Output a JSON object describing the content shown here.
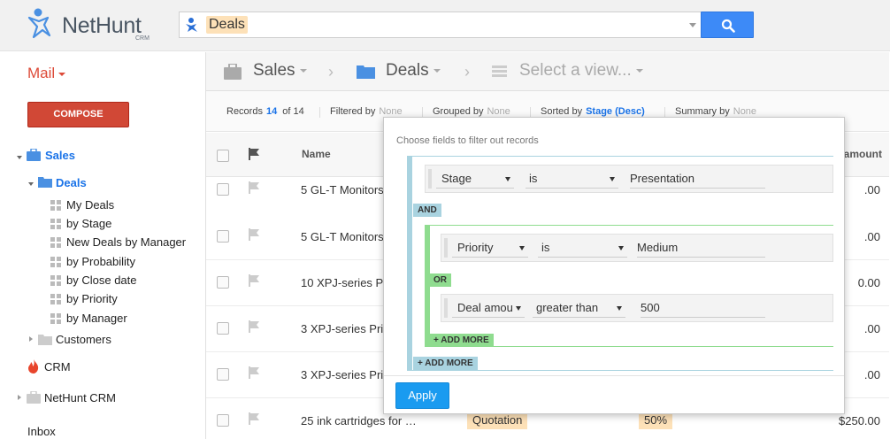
{
  "app": {
    "logo": "NetHunt",
    "logo_sub": "CRM"
  },
  "search": {
    "chip": "Deals"
  },
  "sidebar": {
    "mail": "Mail",
    "compose": "COMPOSE",
    "sales": "Sales",
    "deals": "Deals",
    "views": [
      "My Deals",
      "by Stage",
      "New Deals by Manager",
      "by Probability",
      "by Close date",
      "by Priority",
      "by Manager"
    ],
    "customers": "Customers",
    "crm": "CRM",
    "nethunt_crm": "NetHunt CRM",
    "inbox": "Inbox"
  },
  "breadcrumb": {
    "folder": "Sales",
    "collection": "Deals",
    "view": "Select a view..."
  },
  "stats": {
    "records_label": "Records",
    "records_shown": "14",
    "records_total": "of 14",
    "filtered_label": "Filtered by",
    "filtered_value": "None",
    "grouped_label": "Grouped by",
    "grouped_value": "None",
    "sorted_label": "Sorted by",
    "sorted_value": "Stage (Desc)",
    "summary_label": "Summary by",
    "summary_value": "None"
  },
  "table": {
    "headers": {
      "name": "Name",
      "amount": "amount"
    },
    "rows": [
      {
        "name": "5 GL-T Monitors",
        "amount": ".00"
      },
      {
        "name": "5 GL-T Monitors",
        "amount": ".00"
      },
      {
        "name": "10 XPJ-series P",
        "amount": "0.00"
      },
      {
        "name": "3 XPJ-series Pri",
        "amount": ".00"
      },
      {
        "name": "3 XPJ-series Pri",
        "amount": ".00"
      },
      {
        "name": "25 ink cartridges for …",
        "stage": "Quotation",
        "probability": "50%",
        "amount": "$250.00"
      }
    ]
  },
  "filter": {
    "title": "Choose fields to filter out records",
    "cond1": {
      "field": "Stage",
      "op": "is",
      "value": "Presentation"
    },
    "and_label": "AND",
    "cond2": {
      "field": "Priority",
      "op": "is",
      "value": "Medium"
    },
    "or_label": "OR",
    "cond3": {
      "field": "Deal amou",
      "op": "greater than",
      "value": "500"
    },
    "add_more_inner": "+ ADD MORE",
    "add_more_outer": "+ ADD MORE",
    "apply": "Apply"
  },
  "colors": {
    "accent": "#1a73e8",
    "compose": "#d14836",
    "search_button": "#3d8af7",
    "apply": "#1a9bf0",
    "group_and": "#a9d3e0",
    "group_or": "#8fdc8f",
    "chip": "#fde1b8"
  }
}
